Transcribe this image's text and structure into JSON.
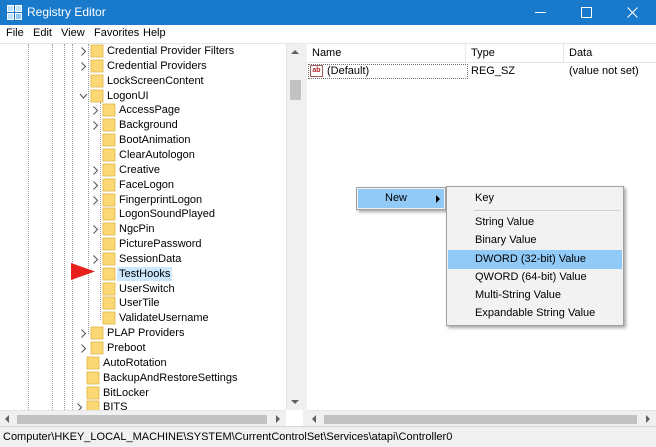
{
  "window": {
    "title": "Registry Editor",
    "title_bar_color": "#1979ca"
  },
  "menubar": {
    "items": [
      "File",
      "Edit",
      "View",
      "Favorites",
      "Help"
    ]
  },
  "tree": {
    "items": [
      {
        "label": "Credential Provider Filters",
        "expander": "collapsed",
        "level": 4
      },
      {
        "label": "Credential Providers",
        "expander": "collapsed",
        "level": 4
      },
      {
        "label": "LockScreenContent",
        "expander": "none",
        "level": 4
      },
      {
        "label": "LogonUI",
        "expander": "expanded",
        "level": 4
      },
      {
        "label": "AccessPage",
        "expander": "collapsed",
        "level": 5
      },
      {
        "label": "Background",
        "expander": "collapsed",
        "level": 5
      },
      {
        "label": "BootAnimation",
        "expander": "none",
        "level": 5
      },
      {
        "label": "ClearAutologon",
        "expander": "none",
        "level": 5
      },
      {
        "label": "Creative",
        "expander": "collapsed",
        "level": 5
      },
      {
        "label": "FaceLogon",
        "expander": "collapsed",
        "level": 5
      },
      {
        "label": "FingerprintLogon",
        "expander": "collapsed",
        "level": 5
      },
      {
        "label": "LogonSoundPlayed",
        "expander": "none",
        "level": 5
      },
      {
        "label": "NgcPin",
        "expander": "collapsed",
        "level": 5
      },
      {
        "label": "PicturePassword",
        "expander": "none",
        "level": 5
      },
      {
        "label": "SessionData",
        "expander": "collapsed",
        "level": 5
      },
      {
        "label": "TestHooks",
        "expander": "none",
        "level": 5,
        "selected": true
      },
      {
        "label": "UserSwitch",
        "expander": "none",
        "level": 5
      },
      {
        "label": "UserTile",
        "expander": "none",
        "level": 5
      },
      {
        "label": "ValidateUsername",
        "expander": "none",
        "level": 5
      },
      {
        "label": "PLAP Providers",
        "expander": "collapsed",
        "level": 4
      },
      {
        "label": "Preboot",
        "expander": "collapsed",
        "level": 4
      },
      {
        "label": "AutoRotation",
        "expander": "none",
        "level": 3
      },
      {
        "label": "BackupAndRestoreSettings",
        "expander": "none",
        "level": 3
      },
      {
        "label": "BitLocker",
        "expander": "none",
        "level": 3
      },
      {
        "label": "BITS",
        "expander": "collapsed",
        "level": 3
      }
    ]
  },
  "list": {
    "columns": [
      "Name",
      "Type",
      "Data"
    ],
    "rows": [
      {
        "icon": "ab",
        "name": "(Default)",
        "type": "REG_SZ",
        "data": "(value not set)"
      }
    ]
  },
  "context_menu": {
    "parent_item": "New",
    "submenu": [
      {
        "label": "Key",
        "highlighted": false
      },
      {
        "label": "String Value",
        "highlighted": false
      },
      {
        "label": "Binary Value",
        "highlighted": false
      },
      {
        "label": "DWORD (32-bit) Value",
        "highlighted": true
      },
      {
        "label": "QWORD (64-bit) Value",
        "highlighted": false
      },
      {
        "label": "Multi-String Value",
        "highlighted": false
      },
      {
        "label": "Expandable String Value",
        "highlighted": false
      }
    ],
    "highlight_color": "#91c9f7"
  },
  "statusbar": {
    "path": "Computer\\HKEY_LOCAL_MACHINE\\SYSTEM\\CurrentControlSet\\Services\\atapi\\Controller0"
  },
  "annotation": {
    "arrow_color": "#e8201c"
  }
}
